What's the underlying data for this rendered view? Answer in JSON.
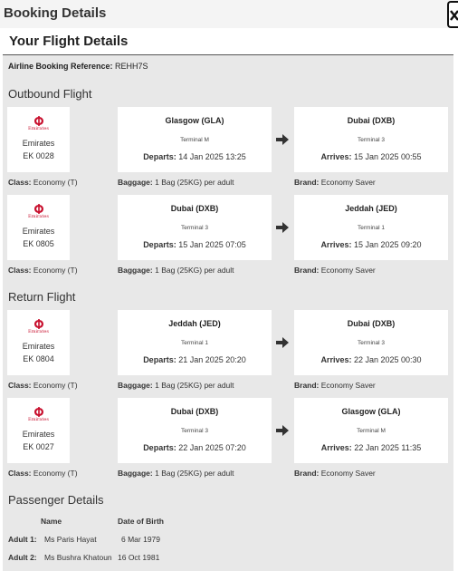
{
  "window": {
    "title": "Booking Details"
  },
  "panel": {
    "title": "Your Flight Details",
    "ref_label": "Airline Booking Reference:",
    "ref_value": "REHH7S"
  },
  "sections": {
    "outbound": "Outbound Flight",
    "return": "Return Flight",
    "passengers": "Passenger Details"
  },
  "labels": {
    "departs": "Departs:",
    "arrives": "Arrives:",
    "class": "Class:",
    "baggage": "Baggage:",
    "brand": "Brand:",
    "logo_text": "Emirates"
  },
  "flights": [
    {
      "airline": "Emirates",
      "number": "EK 0028",
      "from_city": "Glasgow (GLA)",
      "from_terminal": "Terminal M",
      "depart": "14 Jan 2025 13:25",
      "to_city": "Dubai (DXB)",
      "to_terminal": "Terminal 3",
      "arrive": "15 Jan 2025 00:55",
      "class": "Economy (T)",
      "baggage": "1 Bag (25KG) per adult",
      "brand": "Economy Saver"
    },
    {
      "airline": "Emirates",
      "number": "EK 0805",
      "from_city": "Dubai (DXB)",
      "from_terminal": "Terminal 3",
      "depart": "15 Jan 2025 07:05",
      "to_city": "Jeddah (JED)",
      "to_terminal": "Terminal 1",
      "arrive": "15 Jan 2025 09:20",
      "class": "Economy (T)",
      "baggage": "1 Bag (25KG) per adult",
      "brand": "Economy Saver"
    },
    {
      "airline": "Emirates",
      "number": "EK 0804",
      "from_city": "Jeddah (JED)",
      "from_terminal": "Terminal 1",
      "depart": "21 Jan 2025 20:20",
      "to_city": "Dubai (DXB)",
      "to_terminal": "Terminal 3",
      "arrive": "22 Jan 2025 00:30",
      "class": "Economy (T)",
      "baggage": "1 Bag (25KG) per adult",
      "brand": "Economy Saver"
    },
    {
      "airline": "Emirates",
      "number": "EK 0027",
      "from_city": "Dubai (DXB)",
      "from_terminal": "Terminal 3",
      "depart": "22 Jan 2025 07:20",
      "to_city": "Glasgow (GLA)",
      "to_terminal": "Terminal M",
      "arrive": "22 Jan 2025 11:35",
      "class": "Economy (T)",
      "baggage": "1 Bag (25KG) per adult",
      "brand": "Economy Saver"
    }
  ],
  "passengers": {
    "col_name": "Name",
    "col_dob": "Date of Birth",
    "rows": [
      {
        "label": "Adult 1:",
        "name": "Ms Paris Hayat",
        "dob": "6 Mar 1979"
      },
      {
        "label": "Adult 2:",
        "name": "Ms Bushra Khatoun",
        "dob": "16 Oct 1981"
      }
    ]
  },
  "colors": {
    "brand_red": "#c8102e",
    "panel_bg": "#e8e8e8"
  }
}
